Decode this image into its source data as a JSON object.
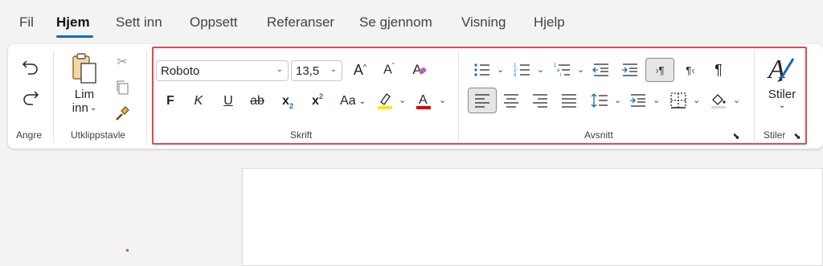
{
  "tabs": [
    {
      "label": "Fil",
      "active": false
    },
    {
      "label": "Hjem",
      "active": true
    },
    {
      "label": "Sett inn",
      "active": false
    },
    {
      "label": "Oppsett",
      "active": false
    },
    {
      "label": "Referanser",
      "active": false
    },
    {
      "label": "Se gjennom",
      "active": false
    },
    {
      "label": "Visning",
      "active": false
    },
    {
      "label": "Hjelp",
      "active": false
    }
  ],
  "groups": {
    "undo": {
      "label": "Angre"
    },
    "clipboard": {
      "label": "Utklippstavle",
      "paste_line1": "Lim",
      "paste_line2": "inn"
    },
    "font": {
      "label": "Skrift",
      "font_name": "Roboto",
      "font_size": "13,5",
      "bold": "F",
      "italic": "K",
      "underline": "U",
      "strike": "ab",
      "subscript": "x",
      "superscript": "x",
      "change_case": "Aa",
      "grow": "A",
      "shrink": "A",
      "clear": "A"
    },
    "paragraph": {
      "label": "Avsnitt"
    },
    "styles": {
      "label": "Stiler",
      "button_label": "Stiler"
    }
  },
  "colors": {
    "accent": "#0f6cbd",
    "highlight_yellow": "#ffe600",
    "font_color_red": "#e00000",
    "callout_border": "#e5484d"
  }
}
